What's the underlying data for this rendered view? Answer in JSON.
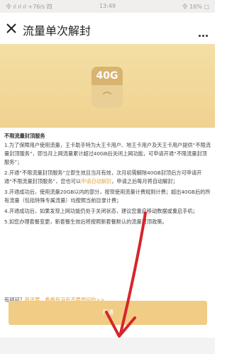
{
  "status": {
    "left": "令 ıl ıl ıl +76/s 四",
    "time": "13:49",
    "right": "令 16% □"
  },
  "nav": {
    "title": "流量单次解封"
  },
  "banner": {
    "label": "40G",
    "symbol": "⌒"
  },
  "content": {
    "heading": "不限流量封顶服务",
    "p1": "1.为了保障用户使用流量，王卡助手特为大王卡用户、地王卡用户及天王卡用户提供“不限流量封顶服务”，即当月上网流量累计超过40GB后关闭上网功能，可申请开通“不限流量封顶服务”；",
    "p2a": "2.开通“不限流量封顶服务”立即生效且当月有效，次月初需解除40GB封顶后方可申请开通“不限流量封顶服务”，您也可以",
    "p2link": "申请自动解封",
    "p2b": "，申请之后每月将自动解封；",
    "p3": "3.开通成功后，使用流量20GB以内的部分，按现使用流量计费规则计费；超出40GB后的所有流量（包括特殊专属流量）均按照当前目录计费；",
    "p4": "4.开通成功后，如果发现上网功能仍处于关闭状态，建议您重启移动数据或重启手机；",
    "p5": "5.如您办理套餐变更，新套餐生效后将按照新套餐默认的流量封顶政策。",
    "feedback_q": "有疑问？",
    "feedback_link": "我还要，看看有没有不要想问的>>",
    "button": "开通"
  },
  "colors": {
    "accent": "#e8a53a",
    "button": "#f1cc84",
    "banner": "#f0d290"
  }
}
